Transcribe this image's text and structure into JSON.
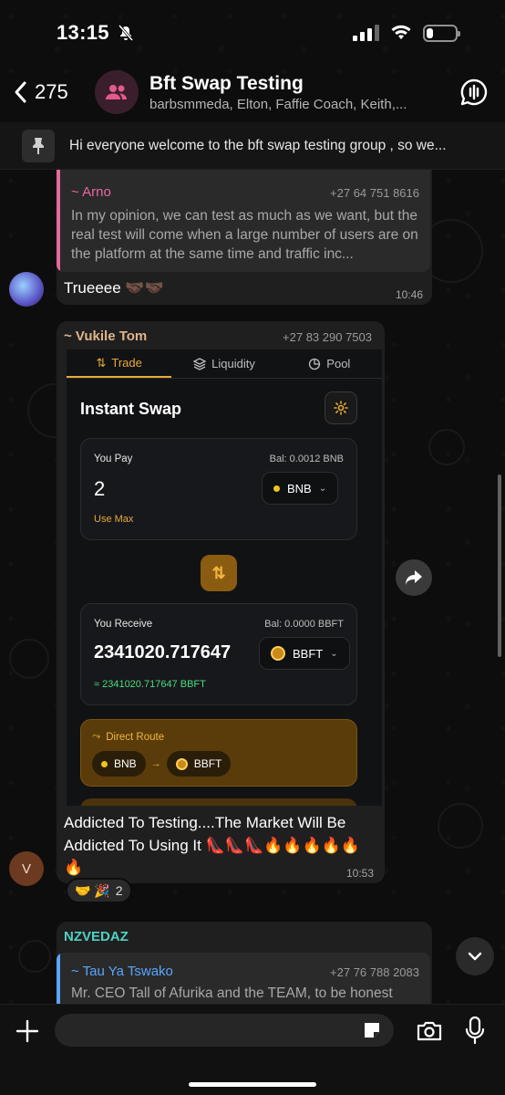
{
  "status_bar": {
    "time": "13:15",
    "battery_level": 0.22
  },
  "header": {
    "back_count": "275",
    "group_name": "Bft Swap Testing",
    "members": "barbsmmeda, Elton, Faffie Coach, Keith,..."
  },
  "pinned": {
    "text": "Hi everyone welcome to the bft swap  testing group , so we..."
  },
  "messages": [
    {
      "quote": {
        "sender": "~ Arno",
        "phone": "+27 64 751 8616",
        "text": "In my opinion, we can test as much as we want, but the real test will come when a large number of users are on the platform at the same time and traffic inc..."
      },
      "text": "Trueeee 🤝🏿🤝🏿",
      "time": "10:46"
    },
    {
      "sender": "~ Vukile Tom",
      "phone": "+27 83 290 7503",
      "text": "Addicted To Testing....The Market Will Be Addicted To Using It 👠👠👠🔥🔥🔥🔥🔥🔥",
      "time": "10:53",
      "avatar_initial": "V",
      "reactions": {
        "emojis": "🤝 🎉",
        "count": "2"
      }
    },
    {
      "sender": "NZVEDAZ",
      "quote": {
        "sender": "~ Tau Ya Tswako",
        "phone": "+27 76 788 2083",
        "text": "Mr. CEO Tall of Afurika and the TEAM, to be honest"
      }
    }
  ],
  "swap_screenshot": {
    "tabs": [
      "Trade",
      "Liquidity",
      "Pool"
    ],
    "title": "Instant Swap",
    "pay": {
      "label": "You Pay",
      "balance": "Bal: 0.0012 BNB",
      "amount": "2",
      "token": "BNB",
      "use_max": "Use Max"
    },
    "receive": {
      "label": "You Receive",
      "balance": "Bal: 0.0000 BBFT",
      "amount": "2341020.717647",
      "token": "BBFT",
      "approx": "≈ 2341020.717647 BBFT"
    },
    "route": {
      "label": "Direct Route",
      "from": "BNB",
      "to": "BBFT"
    }
  },
  "colors": {
    "arno": "#e9679c",
    "vukile": "#e0b48a",
    "nzvedaz": "#4fd1c5",
    "tau": "#58a6ff",
    "accent": "#e8a93a"
  }
}
